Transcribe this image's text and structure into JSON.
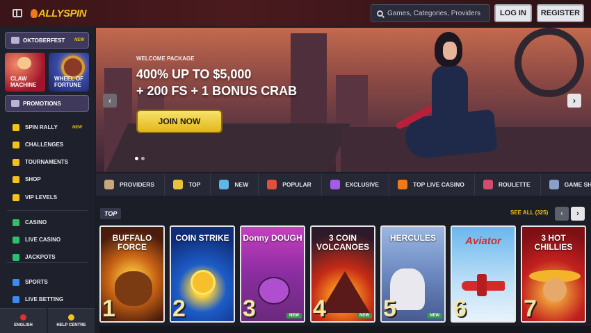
{
  "header": {
    "logo_text": "ALLYSPIN",
    "search_placeholder": "Games, Categories, Providers",
    "login_label": "LOG IN",
    "register_label": "REGISTER"
  },
  "sidebar": {
    "oktoberfest": {
      "label": "OKTOBERFEST",
      "tag": "NEW"
    },
    "tiles": [
      {
        "label_line1": "CLAW",
        "label_line2": "MACHINE"
      },
      {
        "label_line1": "WHEEL OF",
        "label_line2": "FORTUNE"
      }
    ],
    "promotions": {
      "label": "PROMOTIONS"
    },
    "items": [
      {
        "label": "SPIN RALLY",
        "tag": "NEW",
        "icon": "spin-rally-icon",
        "color": "#f4c21b"
      },
      {
        "label": "CHALLENGES",
        "icon": "medal-icon",
        "color": "#f4c21b"
      },
      {
        "label": "TOURNAMENTS",
        "icon": "trophy-icon",
        "color": "#f4c21b"
      },
      {
        "label": "SHOP",
        "icon": "cart-icon",
        "color": "#f4c21b"
      },
      {
        "label": "VIP LEVELS",
        "icon": "diamond-icon",
        "color": "#f4c21b"
      },
      {
        "label": "CASINO",
        "icon": "casino-icon",
        "color": "#2fbf6a"
      },
      {
        "label": "LIVE CASINO",
        "icon": "live-casino-icon",
        "color": "#2fbf6a"
      },
      {
        "label": "JACKPOTS",
        "icon": "clover-icon",
        "color": "#2fbf6a"
      },
      {
        "label": "SPORTS",
        "icon": "sports-icon",
        "color": "#3d8af0"
      },
      {
        "label": "LIVE BETTING",
        "icon": "live-betting-icon",
        "color": "#3d8af0"
      }
    ],
    "footer": [
      {
        "label": "ENGLISH",
        "icon": "canada-flag-icon"
      },
      {
        "label": "HELP CENTRE",
        "icon": "help-icon"
      }
    ]
  },
  "hero": {
    "eyebrow": "WELCOME PACKAGE",
    "title_line1": "400% UP TO $5,000",
    "title_line2": "+ 200 FS + 1 BONUS CRAB",
    "cta": "JOIN NOW",
    "prev_icon": "‹",
    "next_icon": "›"
  },
  "categories": [
    {
      "label": "PROVIDERS",
      "icon": "providers-icon",
      "color": "#c8a77a"
    },
    {
      "label": "TOP",
      "icon": "star-icon",
      "color": "#e7c23a"
    },
    {
      "label": "NEW",
      "icon": "new-icon",
      "color": "#5fb6e8"
    },
    {
      "label": "POPULAR",
      "icon": "popular-icon",
      "color": "#e0513b"
    },
    {
      "label": "EXCLUSIVE",
      "icon": "gem-icon",
      "color": "#a45ce8"
    },
    {
      "label": "TOP LIVE CASINO",
      "icon": "fire-icon",
      "color": "#f07a1b"
    },
    {
      "label": "ROULETTE",
      "icon": "roulette-icon",
      "color": "#d04d6b"
    },
    {
      "label": "GAME SHOWS",
      "icon": "game-shows-icon",
      "color": "#8ba0c8"
    }
  ],
  "top_section": {
    "title": "TOP",
    "see_all": "SEE ALL (325)",
    "prev_icon": "‹",
    "next_icon": "›",
    "games": [
      {
        "title": "BUFFALO FORCE",
        "rank": "1",
        "is_new": false
      },
      {
        "title": "COIN STRIKE",
        "rank": "2",
        "is_new": false
      },
      {
        "title": "Donny DOUGH",
        "rank": "3",
        "is_new": true,
        "tag": "NEW"
      },
      {
        "title": "3 COIN VOLCANOES",
        "rank": "4",
        "is_new": true,
        "tag": "NEW"
      },
      {
        "title": "HERCULES",
        "rank": "5",
        "is_new": true,
        "tag": "NEW"
      },
      {
        "title": "Aviator",
        "rank": "6",
        "is_new": false
      },
      {
        "title": "3 HOT CHILLIES",
        "rank": "7",
        "is_new": false
      }
    ]
  }
}
